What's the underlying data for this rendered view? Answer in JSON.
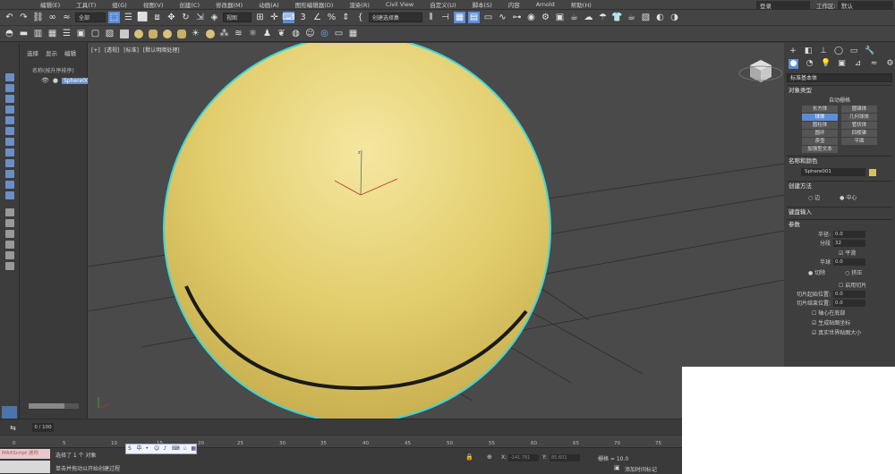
{
  "menu": [
    "编辑(E)",
    "工具(T)",
    "组(G)",
    "视图(V)",
    "创建(C)",
    "修改器(M)",
    "动画(A)",
    "图形编辑器(D)",
    "渲染(R)",
    "Civil View",
    "自定义(U)",
    "脚本(S)",
    "内容",
    "Arnold",
    "帮助(H)"
  ],
  "login": "登录",
  "workspace_label": "工作区:",
  "workspace_value": "默认",
  "toolbar": {
    "filter_dropdown": "全部",
    "ref_coord_dropdown": "视图",
    "selection_set_dropdown": "创建选择集"
  },
  "explorer": {
    "tabs": [
      "选择",
      "显示",
      "编辑"
    ],
    "header": "名称(按升序排序)",
    "object": "Sphere001"
  },
  "viewport": {
    "labels": [
      "[+]",
      "[透视]",
      "[标准]",
      "[默认明暗处理]"
    ],
    "fill": "#e3d070",
    "outline": "#3fd6d6"
  },
  "cmdpanel": {
    "category": "标准基本体",
    "object_type_title": "对象类型",
    "autogrid": "自动栅格",
    "buttons": [
      "长方体",
      "圆锥体",
      "球体",
      "几何球体",
      "圆柱体",
      "管状体",
      "圆环",
      "四棱锥",
      "茶壶",
      "平面",
      "加强型文本"
    ],
    "active_button": "球体",
    "name_color_title": "名称和颜色",
    "name_value": "Sphere001",
    "color": "#d6c16a",
    "create_method_title": "创建方法",
    "create_method": [
      "边",
      "中心"
    ],
    "keyboard_title": "键盘输入",
    "params_title": "参数",
    "radius_label": "半径:",
    "radius_value": "0.0",
    "segments_label": "分段",
    "segments_value": "32",
    "smooth_label": "平滑",
    "hemisphere_label": "半球",
    "hemisphere_value": "0.0",
    "chop_label": "切除",
    "squash_label": "挤压",
    "slice_label": "启用切片",
    "slice_from_label": "切片起始位置:",
    "slice_from_value": "0.0",
    "slice_to_label": "切片结束位置:",
    "slice_to_value": "0.0",
    "base_pivot_label": "轴心在底部",
    "gen_map_label": "生成贴图坐标",
    "real_world_label": "真实世界贴图大小"
  },
  "timeline": {
    "frame": "0 / 100",
    "ticks": [
      "0",
      "5",
      "10",
      "15",
      "20",
      "25",
      "30",
      "35",
      "40",
      "45",
      "50",
      "55",
      "60",
      "65",
      "70",
      "75"
    ]
  },
  "status": {
    "maxscript": "MAXScript 迷你",
    "selected": "选择了 1 个 对象",
    "hint": "单击并拖动以开始创建过程",
    "x_label": "X:",
    "x_value": "-141.761",
    "y_label": "Y:",
    "y_value": "85.601",
    "grid": "栅格 = 10.0",
    "addkey": "添加时间标记"
  }
}
